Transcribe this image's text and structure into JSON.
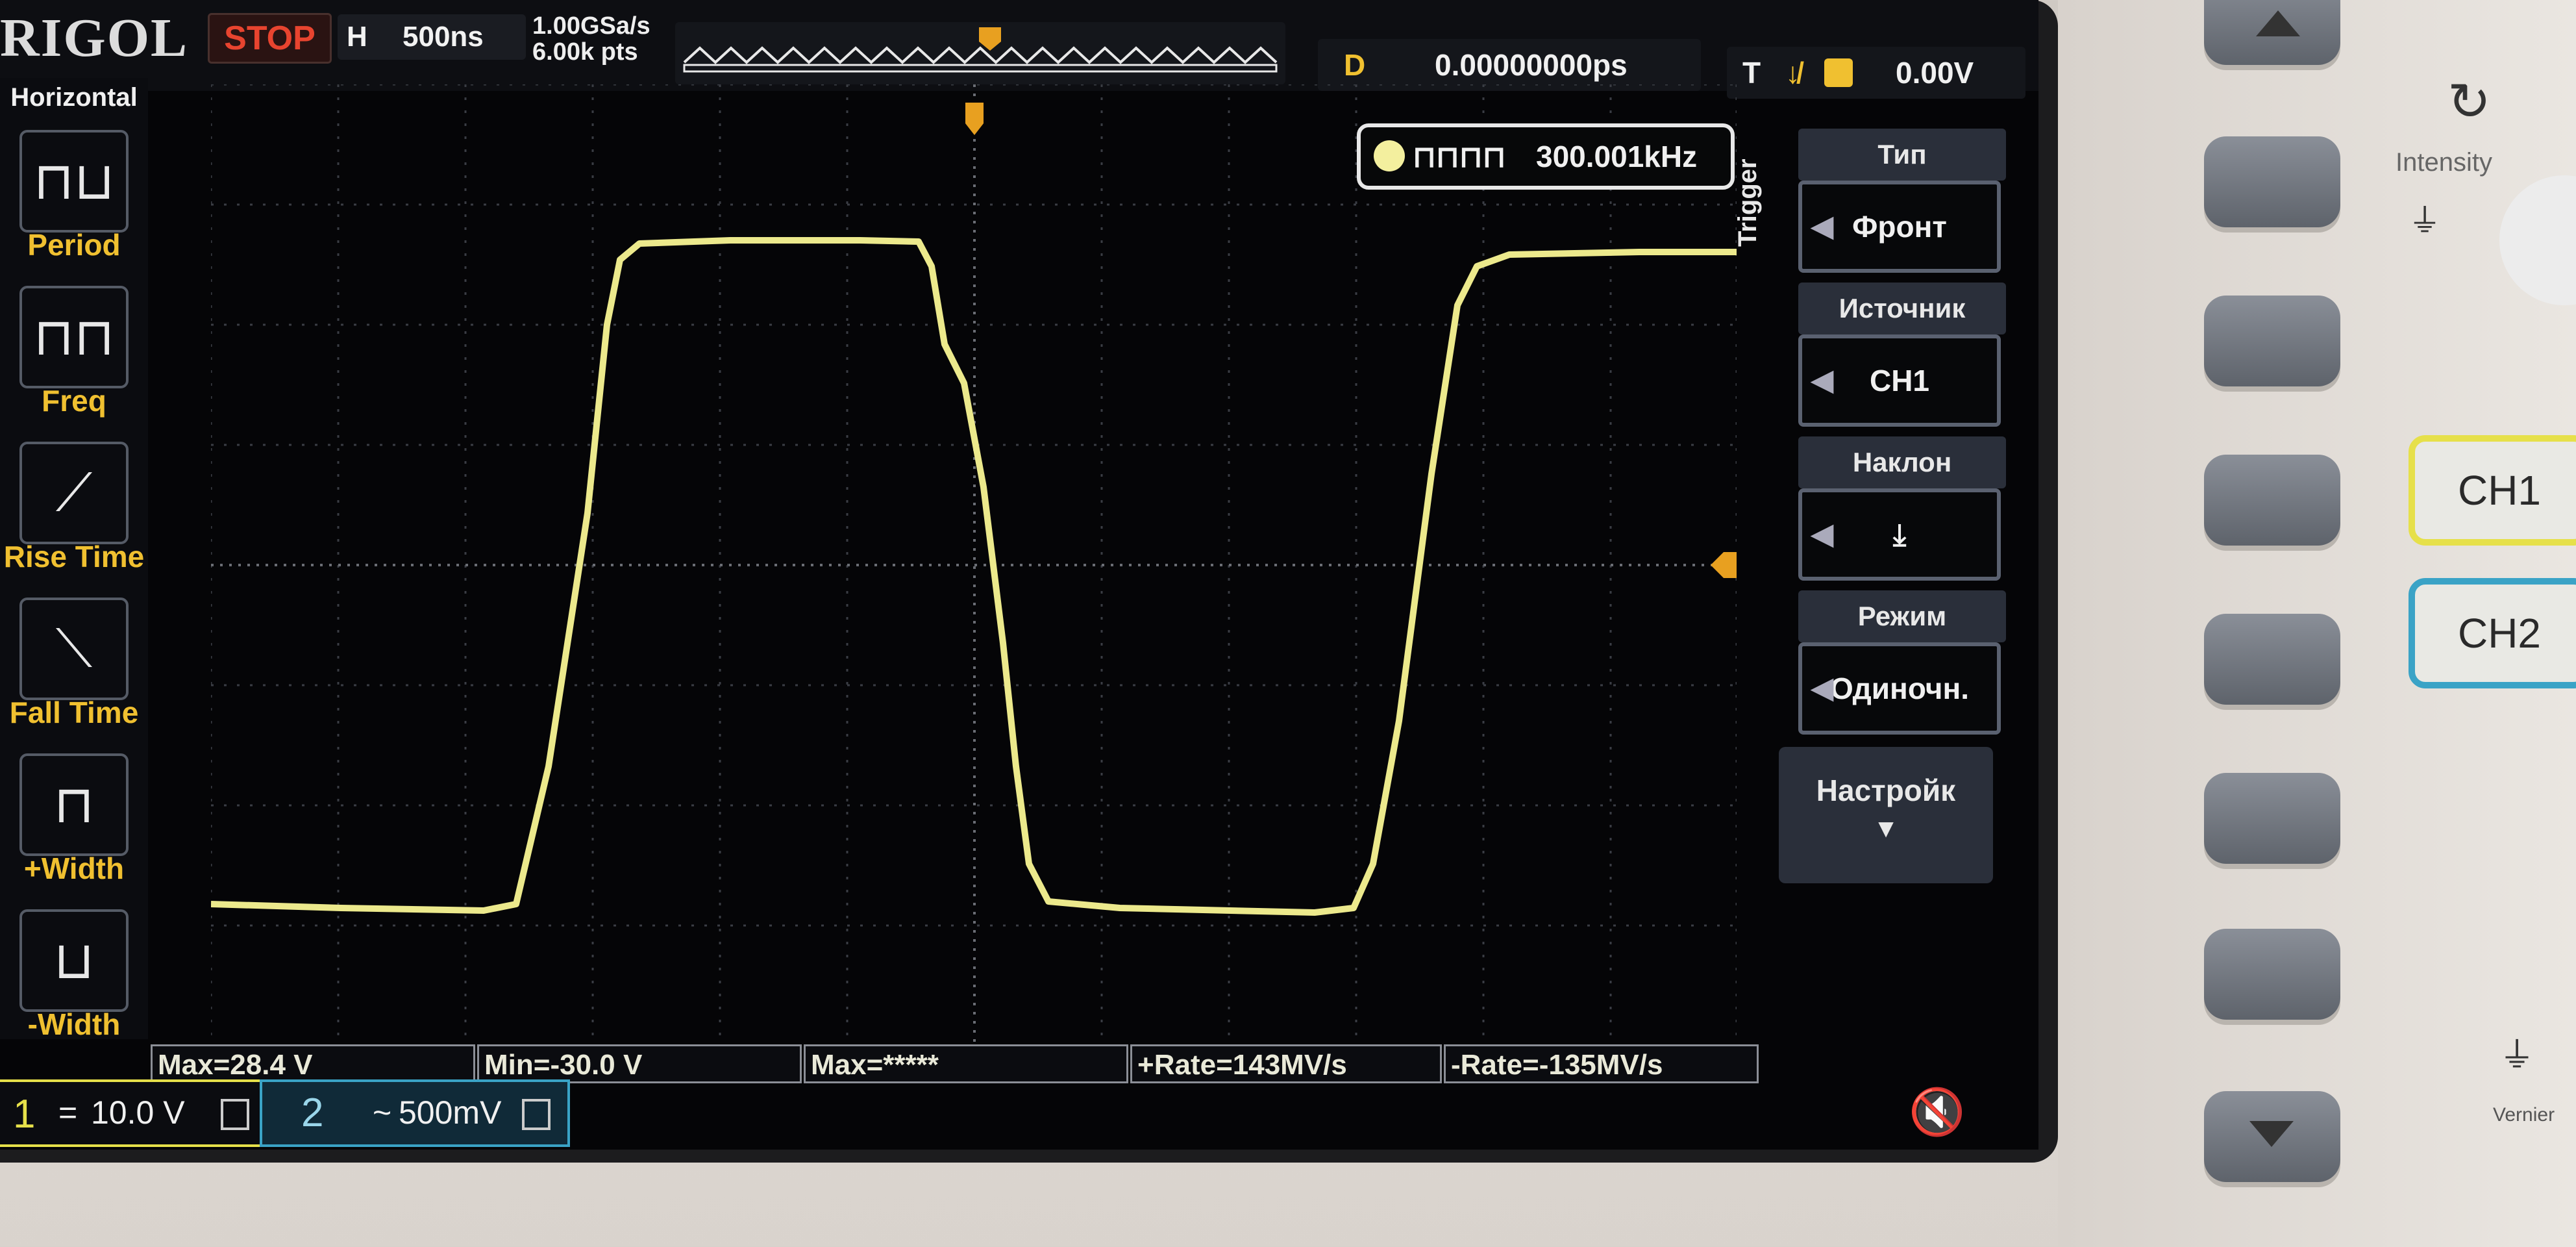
{
  "header": {
    "logo": "RIGOL",
    "run_state": "STOP",
    "timebase_label": "H",
    "timebase_value": "500ns",
    "sample_rate": "1.00GSa/s",
    "memory_depth": "6.00k pts",
    "delay_label": "D",
    "delay_value": "0.00000000ps",
    "trigger_label": "T",
    "trigger_slope_glyph": "↓̸",
    "trigger_level": "0.00V"
  },
  "left_menu": {
    "title": "Horizontal",
    "items": [
      {
        "label": "Period",
        "icon": "period-icon"
      },
      {
        "label": "Freq",
        "icon": "freq-icon"
      },
      {
        "label": "Rise Time",
        "icon": "rise-time-icon"
      },
      {
        "label": "Fall Time",
        "icon": "fall-time-icon"
      },
      {
        "label": "+Width",
        "icon": "pos-width-icon"
      },
      {
        "label": "-Width",
        "icon": "neg-width-icon"
      }
    ]
  },
  "right_menu": {
    "section": "Trigger",
    "items": [
      {
        "header": "Тип",
        "value": "Фронт"
      },
      {
        "header": "Источник",
        "value": "CH1"
      },
      {
        "header": "Наклон",
        "value": "⤓"
      },
      {
        "header": "Режим",
        "value": "Одиночн."
      }
    ],
    "more": "Настройк"
  },
  "frequency_counter": "300.001kHz",
  "measurements": [
    "Max=28.4 V",
    "Min=-30.0 V",
    "Max=*****",
    "+Rate=143MV/s",
    "-Rate=-135MV/s"
  ],
  "channels": {
    "ch1": {
      "number": "1",
      "scale": "10.0 V"
    },
    "ch2": {
      "number": "2",
      "scale": "500mV"
    }
  },
  "panel": {
    "intensity_label": "Intensity",
    "vernier_label": "Vernier",
    "ch1_button": "CH1",
    "ch2_button": "CH2"
  },
  "colors": {
    "trace": "#ece98c",
    "ch1": "#e6e04a",
    "ch2": "#3aa3c6",
    "stop": "#e8442f",
    "menu_text": "#f0c030"
  }
}
